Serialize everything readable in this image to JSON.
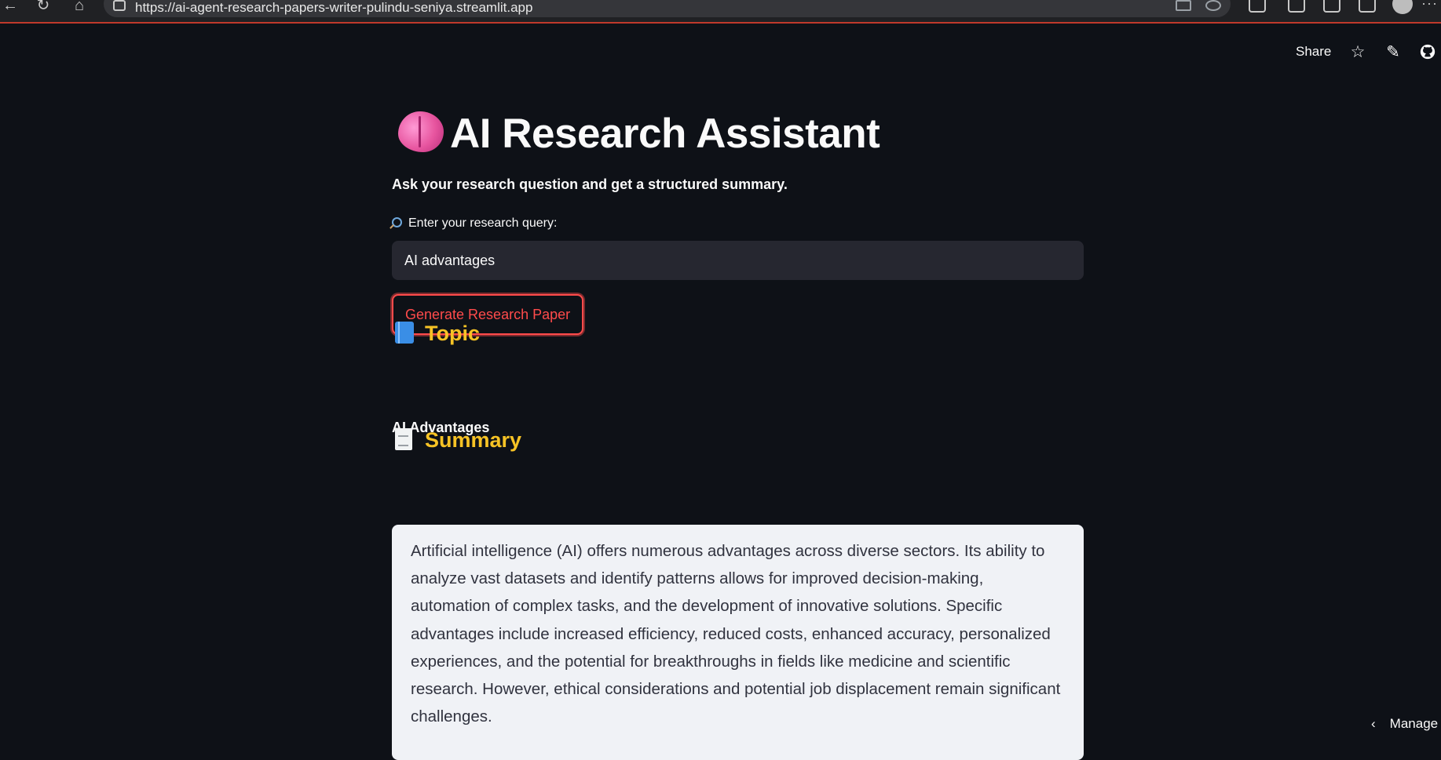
{
  "browser": {
    "url": "https://ai-agent-research-papers-writer-pulindu-seniya.streamlit.app"
  },
  "header": {
    "share_label": "Share",
    "icons": [
      "star-icon",
      "edit-icon",
      "github-icon"
    ]
  },
  "main": {
    "title": "AI Research Assistant",
    "subtitle": "Ask your research question and get a structured summary.",
    "query_label": "Enter your research query:",
    "query_value": "AI advantages",
    "generate_button_label": "Generate Research Paper",
    "topic_heading": "Topic",
    "topic_value": "AI Advantages",
    "summary_heading": "Summary",
    "summary_text": "Artificial intelligence (AI) offers numerous advantages across diverse sectors.  Its ability to analyze vast datasets and identify patterns allows for improved decision-making, automation of complex tasks, and the development of innovative solutions.  Specific advantages include increased efficiency, reduced costs, enhanced accuracy, personalized experiences, and the potential for breakthroughs in fields like medicine and scientific research. However, ethical considerations and potential job displacement remain significant challenges."
  },
  "footer": {
    "manage_label": "Manage"
  },
  "colors": {
    "background": "#0e1117",
    "accent": "#ff4b4b",
    "section_heading": "#f7c325",
    "input_bg": "#262730",
    "summary_bg": "#f0f2f6"
  }
}
